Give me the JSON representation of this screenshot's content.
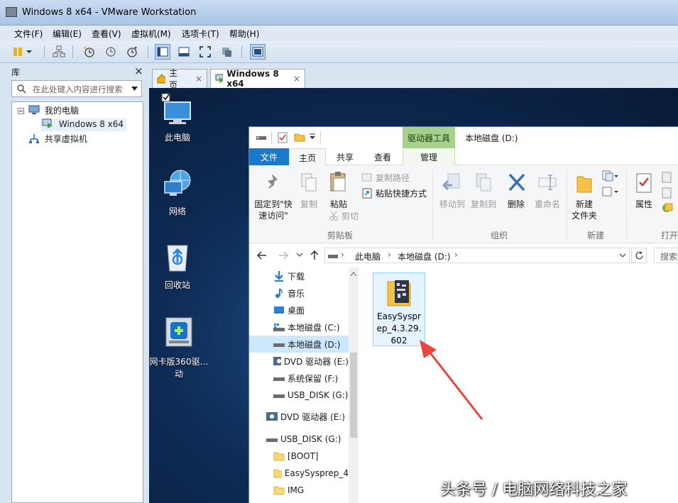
{
  "window": {
    "title": "Windows 8 x64 - VMware Workstation"
  },
  "menu": {
    "items": [
      "文件(F)",
      "编辑(E)",
      "查看(V)",
      "虚拟机(M)",
      "选项卡(T)",
      "帮助(H)"
    ]
  },
  "library": {
    "title": "库",
    "close": "×",
    "search_placeholder": "在此处键入内容进行搜索",
    "tree": {
      "my_computer": "我的电脑",
      "vm": "Windows 8 x64",
      "shared": "共享虚拟机"
    }
  },
  "tabs": {
    "home": "主页",
    "vm": "Windows 8 x64",
    "close": "×"
  },
  "desktop": {
    "icons": [
      "此电脑",
      "网络",
      "回收站",
      "网卡版360驱动"
    ],
    "icon4_line1": "网卡版360驱…",
    "icon4_line2": "动"
  },
  "explorer": {
    "context_tab": "驱动器工具",
    "title": "本地磁盘 (D:)",
    "ribbon_tabs": [
      "文件",
      "主页",
      "共享",
      "查看",
      "管理"
    ],
    "ribbon": {
      "pin_line1": "固定到\"快",
      "pin_line2": "速访问\"",
      "copy": "复制",
      "paste": "粘贴",
      "copy_path": "复制路径",
      "paste_shortcut": "粘贴快捷方式",
      "cut": "剪切",
      "clipboard": "剪贴板",
      "move_to": "移动到",
      "copy_to": "复制到",
      "delete": "删除",
      "rename": "重命名",
      "organize": "组织",
      "new_folder_line1": "新建",
      "new_folder_line2": "文件夹",
      "new": "新建",
      "properties": "属性",
      "open": "打开"
    },
    "address": {
      "parts": [
        "此电脑",
        "本地磁盘 (D:)"
      ],
      "search_placeholder": "搜索"
    },
    "nav": [
      "下载",
      "音乐",
      "桌面",
      "本地磁盘 (C:)",
      "本地磁盘 (D:)",
      "DVD 驱动器 (E:)",
      "系统保留 (F:)",
      "USB_DISK (G:)",
      "DVD 驱动器 (E:) U",
      "USB_DISK (G:)",
      "[BOOT]",
      "EasySysprep_4",
      "IMG"
    ],
    "file": {
      "line1": "EasySyspr",
      "line2": "ep_4.3.29.",
      "line3": "602"
    }
  },
  "watermark": "头条号 / 电脑网络科技之家",
  "colors": {
    "accent": "#1979ca",
    "selection": "#cce8ff",
    "arrow": "#e8453c",
    "context_tab": "#a7d08c"
  }
}
